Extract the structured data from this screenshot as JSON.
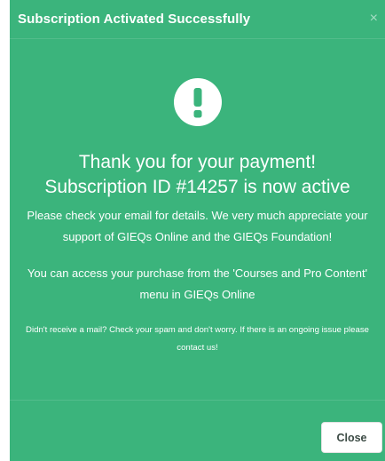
{
  "modal": {
    "title": "Subscription Activated Successfully",
    "close_glyph": "×",
    "icon": "exclamation-circle-icon",
    "headline_line1": "Thank you for your payment!",
    "headline_line2": "Subscription ID #14257 is now active",
    "message1": "Please check your email for details. We very much appreciate your support of GIEQs Online and the GIEQs Foundation!",
    "message2": "You can access your purchase from the 'Courses and Pro Content' menu in GIEQs Online",
    "note": "Didn't receive a mail? Check your spam and don't worry. If there is an ongoing issue please contact us!",
    "close_button_label": "Close"
  },
  "colors": {
    "modal_background": "#3bb47c",
    "text": "#ffffff",
    "button_background": "#ffffff",
    "button_text": "#3c4b45"
  }
}
